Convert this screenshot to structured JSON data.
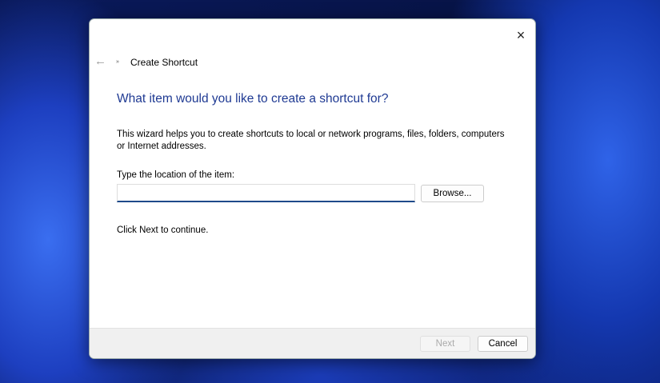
{
  "window": {
    "title": "Create Shortcut",
    "close_icon": "×",
    "back_icon": "←",
    "app_icon": "»"
  },
  "heading": "What item would you like to create a shortcut for?",
  "description": "This wizard helps you to create shortcuts to local or network programs, files, folders, computers or Internet addresses.",
  "location_label": "Type the location of the item:",
  "location_value": "",
  "browse_label": "Browse...",
  "continue_text": "Click Next to continue.",
  "footer": {
    "next_label": "Next",
    "cancel_label": "Cancel"
  }
}
